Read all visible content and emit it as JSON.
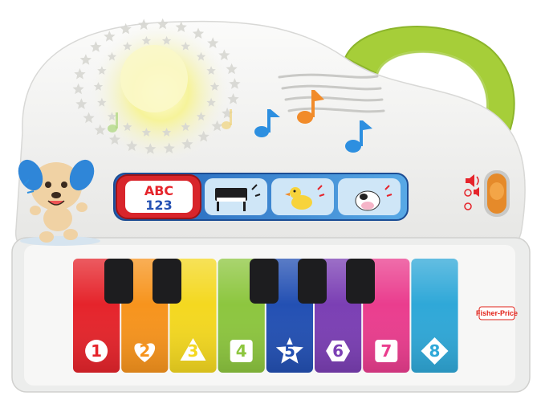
{
  "toy": {
    "brand_logo": "Fisher-Price",
    "mode_buttons": [
      {
        "name": "abc-123",
        "top_text": "ABC",
        "bottom_text": "123",
        "active": true
      },
      {
        "name": "piano",
        "icon": "piano-icon"
      },
      {
        "name": "duck",
        "icon": "duck-icon"
      },
      {
        "name": "cow",
        "icon": "cow-icon"
      }
    ],
    "keys": [
      {
        "number": "1",
        "shape": "circle",
        "color": "#e5242b"
      },
      {
        "number": "2",
        "shape": "heart",
        "color": "#f7941d"
      },
      {
        "number": "3",
        "shape": "triangle",
        "color": "#f4d820"
      },
      {
        "number": "4",
        "shape": "square",
        "color": "#8dc63f"
      },
      {
        "number": "5",
        "shape": "star",
        "color": "#2350b3"
      },
      {
        "number": "6",
        "shape": "hexagon",
        "color": "#7b3fb4"
      },
      {
        "number": "7",
        "shape": "square",
        "color": "#ea3d8e"
      },
      {
        "number": "8",
        "shape": "diamond",
        "color": "#2fa8d8"
      }
    ],
    "volume_switch": {
      "icons": [
        "speaker-high-icon",
        "speaker-off-icon"
      ]
    },
    "colors": {
      "body": "#f4f4f2",
      "handle": "#a6ce39",
      "star_light": "#f7f5b0",
      "black_key": "#1d1d1f"
    }
  }
}
